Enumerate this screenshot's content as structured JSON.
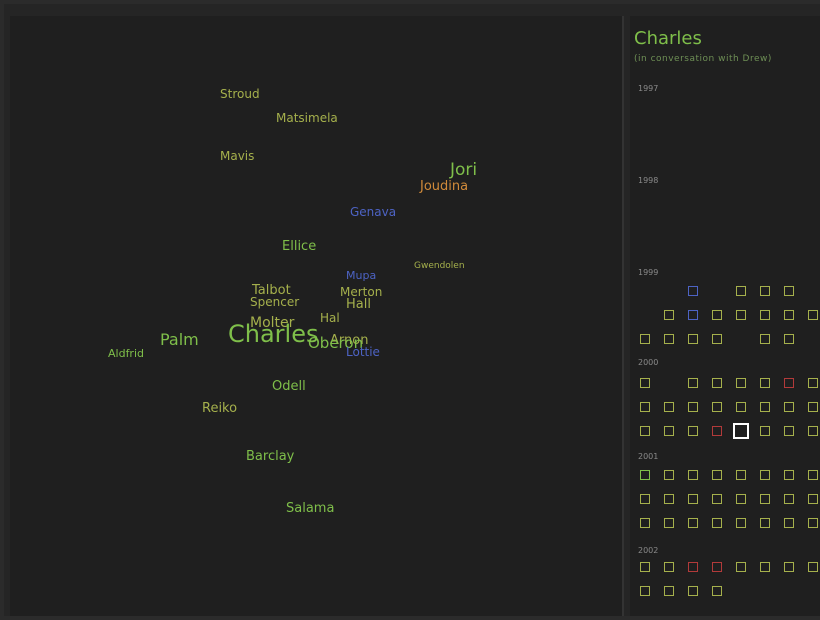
{
  "colors": {
    "background": "#1f1f1f",
    "green": "#7fbf4a",
    "olive": "#a5b04c",
    "blue": "#4d63c4",
    "orange": "#d08a3a",
    "red": "#b23a3a",
    "selected": "#ffffff"
  },
  "cloud": [
    {
      "id": "Stroud",
      "text": "Stroud",
      "color": "olive"
    },
    {
      "id": "Matsimela",
      "text": "Matsimela",
      "color": "olive"
    },
    {
      "id": "Mavis",
      "text": "Mavis",
      "color": "olive"
    },
    {
      "id": "Jori",
      "text": "Jori",
      "color": "green"
    },
    {
      "id": "Joudina",
      "text": "Joudina",
      "color": "orange"
    },
    {
      "id": "Genava",
      "text": "Genava",
      "color": "blue"
    },
    {
      "id": "Ellice",
      "text": "Ellice",
      "color": "green"
    },
    {
      "id": "Gwendolen",
      "text": "Gwendolen",
      "color": "olive"
    },
    {
      "id": "Mupa",
      "text": "Mupa",
      "color": "blue"
    },
    {
      "id": "Talbot",
      "text": "Talbot",
      "color": "olive"
    },
    {
      "id": "Merton",
      "text": "Merton",
      "color": "olive"
    },
    {
      "id": "Spencer",
      "text": "Spencer",
      "color": "olive"
    },
    {
      "id": "Hall",
      "text": "Hall",
      "color": "olive"
    },
    {
      "id": "Hal",
      "text": "Hal",
      "color": "olive"
    },
    {
      "id": "Molter",
      "text": "Molter",
      "color": "olive"
    },
    {
      "id": "Palm",
      "text": "Palm",
      "color": "green"
    },
    {
      "id": "Charles",
      "text": "Charles",
      "color": "green"
    },
    {
      "id": "Arnon",
      "text": "Arnon",
      "color": "olive"
    },
    {
      "id": "Oberon",
      "text": "Oberon",
      "color": "green"
    },
    {
      "id": "Lottie",
      "text": "Lottie",
      "color": "blue"
    },
    {
      "id": "Aldfrid",
      "text": "Aldfrid",
      "color": "green"
    },
    {
      "id": "Odell",
      "text": "Odell",
      "color": "green"
    },
    {
      "id": "Reiko",
      "text": "Reiko",
      "color": "olive"
    },
    {
      "id": "Barclay",
      "text": "Barclay",
      "color": "green"
    },
    {
      "id": "Salama",
      "text": "Salama",
      "color": "green"
    }
  ],
  "calendar": {
    "title": "Charles",
    "subtitle": "(in conversation with Drew)",
    "years": [
      "1997",
      "1998",
      "1999",
      "2000",
      "2001",
      "2002"
    ],
    "cells": [
      {
        "row": 0,
        "col": 2,
        "c": "blue"
      },
      {
        "row": 0,
        "col": 4,
        "c": "olive"
      },
      {
        "row": 0,
        "col": 5,
        "c": "olive"
      },
      {
        "row": 0,
        "col": 6,
        "c": "olive"
      },
      {
        "row": 1,
        "col": 1,
        "c": "olive"
      },
      {
        "row": 1,
        "col": 2,
        "c": "blue"
      },
      {
        "row": 1,
        "col": 3,
        "c": "olive"
      },
      {
        "row": 1,
        "col": 4,
        "c": "olive"
      },
      {
        "row": 1,
        "col": 5,
        "c": "olive"
      },
      {
        "row": 1,
        "col": 6,
        "c": "olive"
      },
      {
        "row": 1,
        "col": 7,
        "c": "olive"
      },
      {
        "row": 2,
        "col": 0,
        "c": "olive"
      },
      {
        "row": 2,
        "col": 1,
        "c": "olive"
      },
      {
        "row": 2,
        "col": 2,
        "c": "olive"
      },
      {
        "row": 2,
        "col": 3,
        "c": "olive"
      },
      {
        "row": 2,
        "col": 5,
        "c": "olive"
      },
      {
        "row": 2,
        "col": 6,
        "c": "olive"
      },
      {
        "row": 3,
        "col": 0,
        "c": "olive"
      },
      {
        "row": 3,
        "col": 2,
        "c": "olive"
      },
      {
        "row": 3,
        "col": 3,
        "c": "olive"
      },
      {
        "row": 3,
        "col": 4,
        "c": "olive"
      },
      {
        "row": 3,
        "col": 5,
        "c": "olive"
      },
      {
        "row": 3,
        "col": 6,
        "c": "red"
      },
      {
        "row": 3,
        "col": 7,
        "c": "olive"
      },
      {
        "row": 4,
        "col": 0,
        "c": "olive"
      },
      {
        "row": 4,
        "col": 1,
        "c": "olive"
      },
      {
        "row": 4,
        "col": 2,
        "c": "olive"
      },
      {
        "row": 4,
        "col": 3,
        "c": "olive"
      },
      {
        "row": 4,
        "col": 4,
        "c": "olive"
      },
      {
        "row": 4,
        "col": 5,
        "c": "olive"
      },
      {
        "row": 4,
        "col": 6,
        "c": "olive"
      },
      {
        "row": 4,
        "col": 7,
        "c": "olive"
      },
      {
        "row": 5,
        "col": 0,
        "c": "olive"
      },
      {
        "row": 5,
        "col": 1,
        "c": "olive"
      },
      {
        "row": 5,
        "col": 2,
        "c": "olive"
      },
      {
        "row": 5,
        "col": 3,
        "c": "red"
      },
      {
        "row": 5,
        "col": 4,
        "c": "selected"
      },
      {
        "row": 5,
        "col": 5,
        "c": "olive"
      },
      {
        "row": 5,
        "col": 6,
        "c": "olive"
      },
      {
        "row": 5,
        "col": 7,
        "c": "olive"
      },
      {
        "row": 6,
        "col": 0,
        "c": "green"
      },
      {
        "row": 6,
        "col": 1,
        "c": "olive"
      },
      {
        "row": 6,
        "col": 2,
        "c": "olive"
      },
      {
        "row": 6,
        "col": 3,
        "c": "olive"
      },
      {
        "row": 6,
        "col": 4,
        "c": "olive"
      },
      {
        "row": 6,
        "col": 5,
        "c": "olive"
      },
      {
        "row": 6,
        "col": 6,
        "c": "olive"
      },
      {
        "row": 6,
        "col": 7,
        "c": "olive"
      },
      {
        "row": 7,
        "col": 0,
        "c": "olive"
      },
      {
        "row": 7,
        "col": 1,
        "c": "olive"
      },
      {
        "row": 7,
        "col": 2,
        "c": "olive"
      },
      {
        "row": 7,
        "col": 3,
        "c": "olive"
      },
      {
        "row": 7,
        "col": 4,
        "c": "olive"
      },
      {
        "row": 7,
        "col": 5,
        "c": "olive"
      },
      {
        "row": 7,
        "col": 6,
        "c": "olive"
      },
      {
        "row": 7,
        "col": 7,
        "c": "olive"
      },
      {
        "row": 8,
        "col": 0,
        "c": "olive"
      },
      {
        "row": 8,
        "col": 1,
        "c": "olive"
      },
      {
        "row": 8,
        "col": 2,
        "c": "olive"
      },
      {
        "row": 8,
        "col": 3,
        "c": "olive"
      },
      {
        "row": 8,
        "col": 4,
        "c": "olive"
      },
      {
        "row": 8,
        "col": 5,
        "c": "olive"
      },
      {
        "row": 8,
        "col": 6,
        "c": "olive"
      },
      {
        "row": 8,
        "col": 7,
        "c": "olive"
      },
      {
        "row": 9,
        "col": 0,
        "c": "olive"
      },
      {
        "row": 9,
        "col": 1,
        "c": "olive"
      },
      {
        "row": 9,
        "col": 2,
        "c": "red"
      },
      {
        "row": 9,
        "col": 3,
        "c": "red"
      },
      {
        "row": 9,
        "col": 4,
        "c": "olive"
      },
      {
        "row": 9,
        "col": 5,
        "c": "olive"
      },
      {
        "row": 9,
        "col": 6,
        "c": "olive"
      },
      {
        "row": 9,
        "col": 7,
        "c": "olive"
      },
      {
        "row": 10,
        "col": 0,
        "c": "olive"
      },
      {
        "row": 10,
        "col": 1,
        "c": "olive"
      },
      {
        "row": 10,
        "col": 2,
        "c": "olive"
      },
      {
        "row": 10,
        "col": 3,
        "c": "olive"
      }
    ]
  }
}
